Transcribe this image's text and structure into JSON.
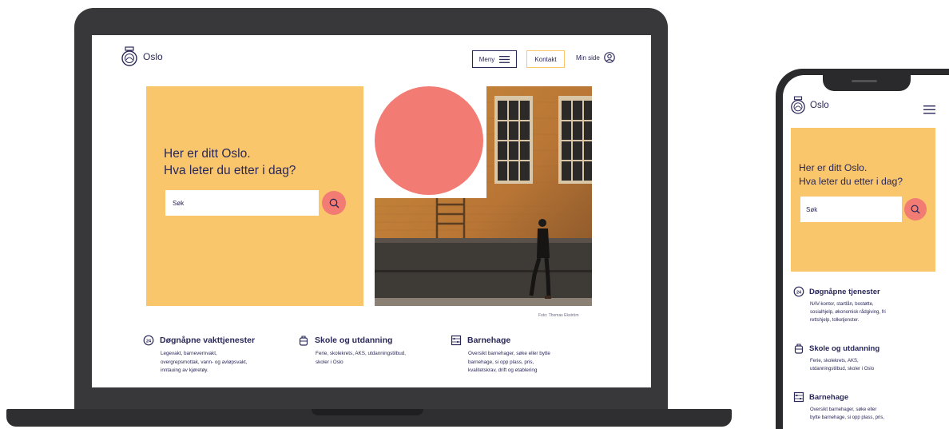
{
  "desktop": {
    "logo_text": "Oslo",
    "menu_label": "Meny",
    "contact_label": "Kontakt",
    "mypage_label": "Min side",
    "hero": {
      "line1": "Her er ditt Oslo.",
      "line2": "Hva leter du etter i dag?",
      "search_placeholder": "Søk"
    },
    "photo_credit": "Foto: Thomas Ekström",
    "services": [
      {
        "title": "Døgnåpne vakttjenester",
        "icon": "24h-clock-icon",
        "lines": [
          "Legevakt, barnevernvakt,",
          "overgrepsmottak, vann- og avløpsvakt,",
          "inntauing av kjøretøy."
        ]
      },
      {
        "title": "Skole og utdanning",
        "icon": "backpack-icon",
        "lines": [
          "Ferie, skolekrets, AKS, utdanningstilbud,",
          "skoler i Oslo"
        ]
      },
      {
        "title": "Barnehage",
        "icon": "abacus-icon",
        "lines": [
          "Oversikt barnehager, søke eller bytte",
          "barnehage, si opp plass, pris,",
          "kvalitetskrav, drift og etablering"
        ]
      }
    ]
  },
  "mobile": {
    "logo_text": "Oslo",
    "hero": {
      "line1": "Her er ditt Oslo.",
      "line2": "Hva leter du etter i dag?",
      "search_placeholder": "Søk"
    },
    "services": [
      {
        "title": "Døgnåpne tjenester",
        "icon": "24h-clock-icon",
        "lines": [
          "NAV-kontor, startlån, bostøtte,",
          "sosialhjelp, økonomisk rådgiving, fri",
          "rettshjelp, tolketjenster."
        ]
      },
      {
        "title": "Skole og utdanning",
        "icon": "backpack-icon",
        "lines": [
          "Ferie, skolekrets, AKS,",
          "utdanningstilbud, skoler i Oslo"
        ]
      },
      {
        "title": "Barnehage",
        "icon": "abacus-icon",
        "lines": [
          "Oversikt barnehager, søke eller",
          "bytte barnehage, si opp plass, pris,"
        ]
      }
    ]
  },
  "colors": {
    "navy": "#2a2859",
    "yellow": "#f9c66b",
    "coral": "#f27c73",
    "device": "#38383b"
  }
}
